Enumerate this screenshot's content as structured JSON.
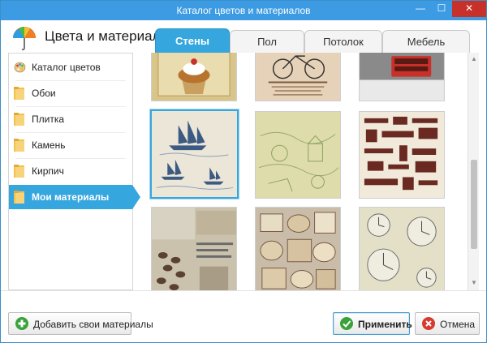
{
  "window": {
    "title": "Каталог цветов и материалов",
    "min_glyph": "—",
    "max_glyph": "☐",
    "close_glyph": "✕"
  },
  "header": {
    "app_title": "Цвета и материалы"
  },
  "tabs": [
    {
      "label": "Стены",
      "active": true
    },
    {
      "label": "Пол",
      "active": false
    },
    {
      "label": "Потолок",
      "active": false
    },
    {
      "label": "Мебель",
      "active": false
    }
  ],
  "sidebar": {
    "items": [
      {
        "label": "Каталог цветов",
        "icon": "palette-icon",
        "active": false
      },
      {
        "label": "Обои",
        "icon": "folder-icon",
        "active": false
      },
      {
        "label": "Плитка",
        "icon": "folder-icon",
        "active": false
      },
      {
        "label": "Камень",
        "icon": "folder-icon",
        "active": false
      },
      {
        "label": "Кирпич",
        "icon": "folder-icon",
        "active": false
      },
      {
        "label": "Мои материалы",
        "icon": "folder-icon",
        "active": true
      }
    ]
  },
  "materials": [
    {
      "name": "cupcake-texture",
      "selected": false
    },
    {
      "name": "bicycle-poster-texture",
      "selected": false
    },
    {
      "name": "red-bus-photo-texture",
      "selected": false
    },
    {
      "name": "sailing-ships-texture",
      "selected": true
    },
    {
      "name": "vintage-map-texture",
      "selected": false
    },
    {
      "name": "coffee-lettering-texture",
      "selected": false
    },
    {
      "name": "coffee-collage-texture",
      "selected": false
    },
    {
      "name": "vintage-labels-texture",
      "selected": false
    },
    {
      "name": "clocks-texture",
      "selected": false
    }
  ],
  "footer": {
    "add_label": "Добавить свои материалы",
    "apply_label": "Применить",
    "cancel_label": "Отмена"
  },
  "colors": {
    "accent": "#36a6de",
    "titlebar": "#3d9be3",
    "close": "#c8312a"
  }
}
